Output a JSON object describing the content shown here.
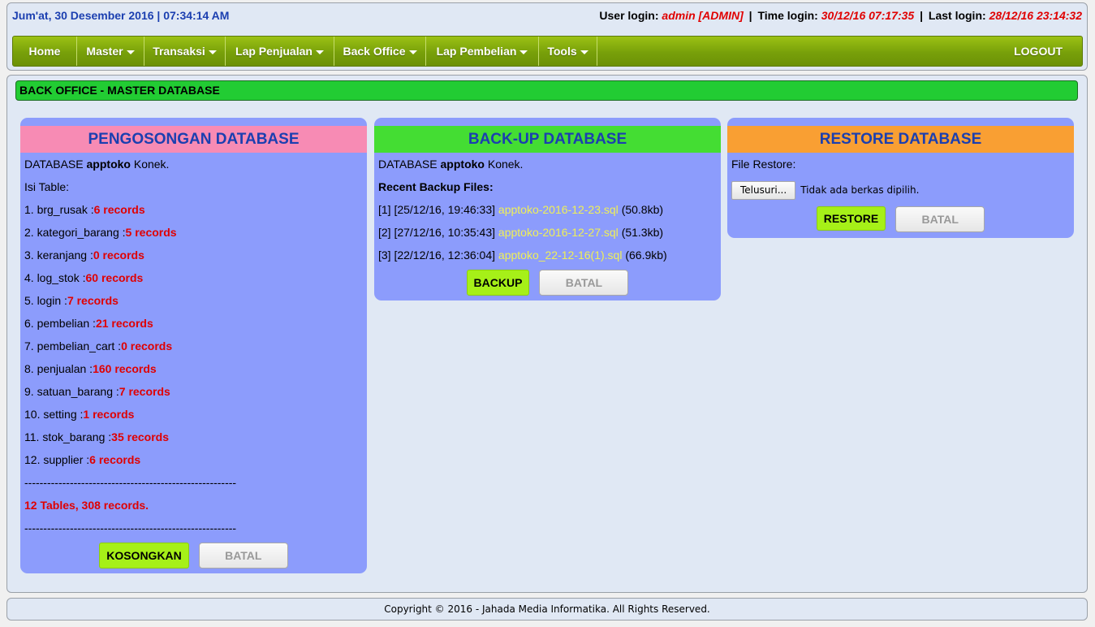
{
  "header": {
    "datetime": "Jum'at, 30 Desember 2016 | 07:34:14 AM",
    "user_login_label": "User login:",
    "user_login_value": "admin [ADMIN]",
    "sep": "|",
    "time_login_label": "Time login:",
    "time_login_value": "30/12/16 07:17:35",
    "last_login_label": "Last login:",
    "last_login_value": "28/12/16 23:14:32"
  },
  "menu": {
    "items": [
      {
        "label": "Home",
        "dropdown": false
      },
      {
        "label": "Master",
        "dropdown": true
      },
      {
        "label": "Transaksi",
        "dropdown": true
      },
      {
        "label": "Lap Penjualan",
        "dropdown": true
      },
      {
        "label": "Back Office",
        "dropdown": true
      },
      {
        "label": "Lap Pembelian",
        "dropdown": true
      },
      {
        "label": "Tools",
        "dropdown": true
      }
    ],
    "logout": "LOGOUT"
  },
  "page_title": "BACK OFFICE - MASTER DATABASE",
  "panel_empty": {
    "title": "PENGOSONGAN DATABASE",
    "db_prefix": "DATABASE",
    "db_name": "apptoko",
    "db_suffix": "Konek.",
    "table_heading": "Isi Table:",
    "tables": [
      {
        "name": "1. brg_rusak :",
        "records": "6 records"
      },
      {
        "name": "2. kategori_barang :",
        "records": "5 records"
      },
      {
        "name": "3. keranjang :",
        "records": "0 records"
      },
      {
        "name": "4. log_stok :",
        "records": "60 records"
      },
      {
        "name": "5. login :",
        "records": "7 records"
      },
      {
        "name": "6. pembelian :",
        "records": "21 records"
      },
      {
        "name": "7. pembelian_cart :",
        "records": "0 records"
      },
      {
        "name": "8. penjualan :",
        "records": "160 records"
      },
      {
        "name": "9. satuan_barang :",
        "records": "7 records"
      },
      {
        "name": "10. setting :",
        "records": "1 records"
      },
      {
        "name": "11. stok_barang :",
        "records": "35 records"
      },
      {
        "name": "12. supplier :",
        "records": "6 records"
      }
    ],
    "divider": "--------------------------------------------------------",
    "summary": "12 Tables, 308 records.",
    "btn_primary": "KOSONGKAN",
    "btn_cancel": "BATAL"
  },
  "panel_backup": {
    "title": "BACK-UP DATABASE",
    "db_prefix": "DATABASE",
    "db_name": "apptoko",
    "db_suffix": "Konek.",
    "recent_heading": "Recent Backup Files:",
    "files": [
      {
        "index": "[1] [25/12/16, 19:46:33]",
        "file": "apptoko-2016-12-23.sql",
        "size": "(50.8kb)"
      },
      {
        "index": "[2] [27/12/16, 10:35:43]",
        "file": "apptoko-2016-12-27.sql",
        "size": "(51.3kb)"
      },
      {
        "index": "[3] [22/12/16, 12:36:04]",
        "file": "apptoko_22-12-16(1).sql",
        "size": "(66.9kb)"
      }
    ],
    "btn_primary": "BACKUP",
    "btn_cancel": "BATAL"
  },
  "panel_restore": {
    "title": "RESTORE DATABASE",
    "file_label": "File Restore:",
    "browse_label": "Telusuri...",
    "no_file": "Tidak ada berkas dipilih.",
    "btn_primary": "RESTORE",
    "btn_cancel": "BATAL"
  },
  "colors": {
    "empty_header": "#f78bb4",
    "backup_header": "#44dd33",
    "restore_header": "#f99f33",
    "panel_bg": "#8c9cfc",
    "record_red": "#e00000",
    "title_blue": "#1b3fb0"
  },
  "footer": {
    "copyright": "Copyright © 2016 - Jahada Media Informatika. All Rights Reserved."
  }
}
